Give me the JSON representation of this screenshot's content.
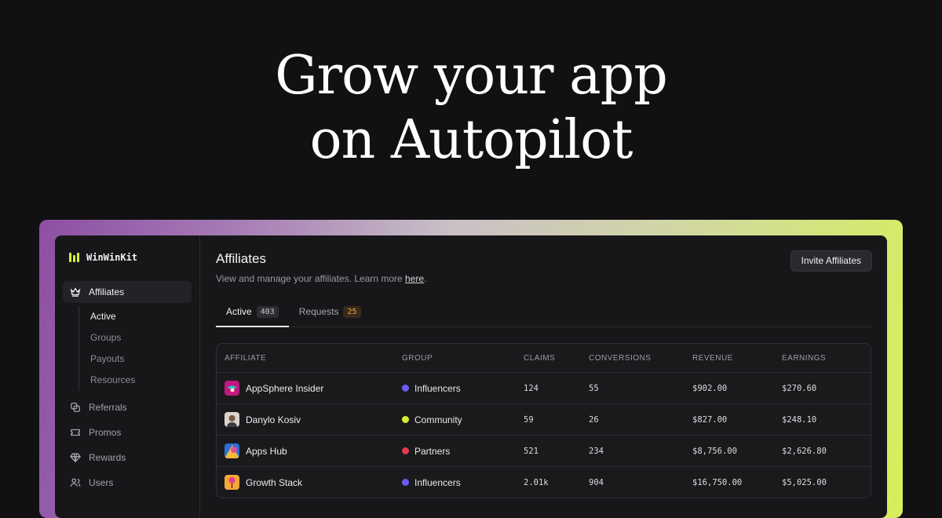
{
  "hero": {
    "line1": "Grow your app",
    "line2": "on Autopilot"
  },
  "brand": {
    "name": "WinWinKit",
    "accent": "#d6ef3a"
  },
  "sidebar": {
    "items": [
      {
        "label": "Affiliates",
        "icon": "crown-icon",
        "active": true
      },
      {
        "label": "Referrals",
        "icon": "referrals-icon"
      },
      {
        "label": "Promos",
        "icon": "ticket-icon"
      },
      {
        "label": "Rewards",
        "icon": "diamond-icon"
      },
      {
        "label": "Users",
        "icon": "users-icon"
      }
    ],
    "subitems": [
      {
        "label": "Active",
        "active": true
      },
      {
        "label": "Groups"
      },
      {
        "label": "Payouts"
      },
      {
        "label": "Resources"
      }
    ]
  },
  "header": {
    "title": "Affiliates",
    "subtitle": "View and manage your affiliates. Learn more ",
    "link": "here",
    "subtitle_end": ".",
    "invite_label": "Invite Affiliates"
  },
  "tabs": [
    {
      "label": "Active",
      "count": "403"
    },
    {
      "label": "Requests",
      "count": "25"
    }
  ],
  "table": {
    "columns": [
      "AFFILIATE",
      "GROUP",
      "CLAIMS",
      "CONVERSIONS",
      "REVENUE",
      "EARNINGS"
    ],
    "rows": [
      {
        "affiliate": "AppSphere Insider",
        "group": "Influencers",
        "group_color": "#6b5cf0",
        "claims": "124",
        "conversions": "55",
        "revenue": "$902.00",
        "earnings": "$270.60"
      },
      {
        "affiliate": "Danylo Kosiv",
        "group": "Community",
        "group_color": "#d8f02c",
        "claims": "59",
        "conversions": "26",
        "revenue": "$827.00",
        "earnings": "$248.10"
      },
      {
        "affiliate": "Apps Hub",
        "group": "Partners",
        "group_color": "#e33a4c",
        "claims": "521",
        "conversions": "234",
        "revenue": "$8,756.00",
        "earnings": "$2,626.80"
      },
      {
        "affiliate": "Growth Stack",
        "group": "Influencers",
        "group_color": "#6b5cf0",
        "claims": "2.01k",
        "conversions": "904",
        "revenue": "$16,750.00",
        "earnings": "$5,025.00"
      }
    ]
  }
}
